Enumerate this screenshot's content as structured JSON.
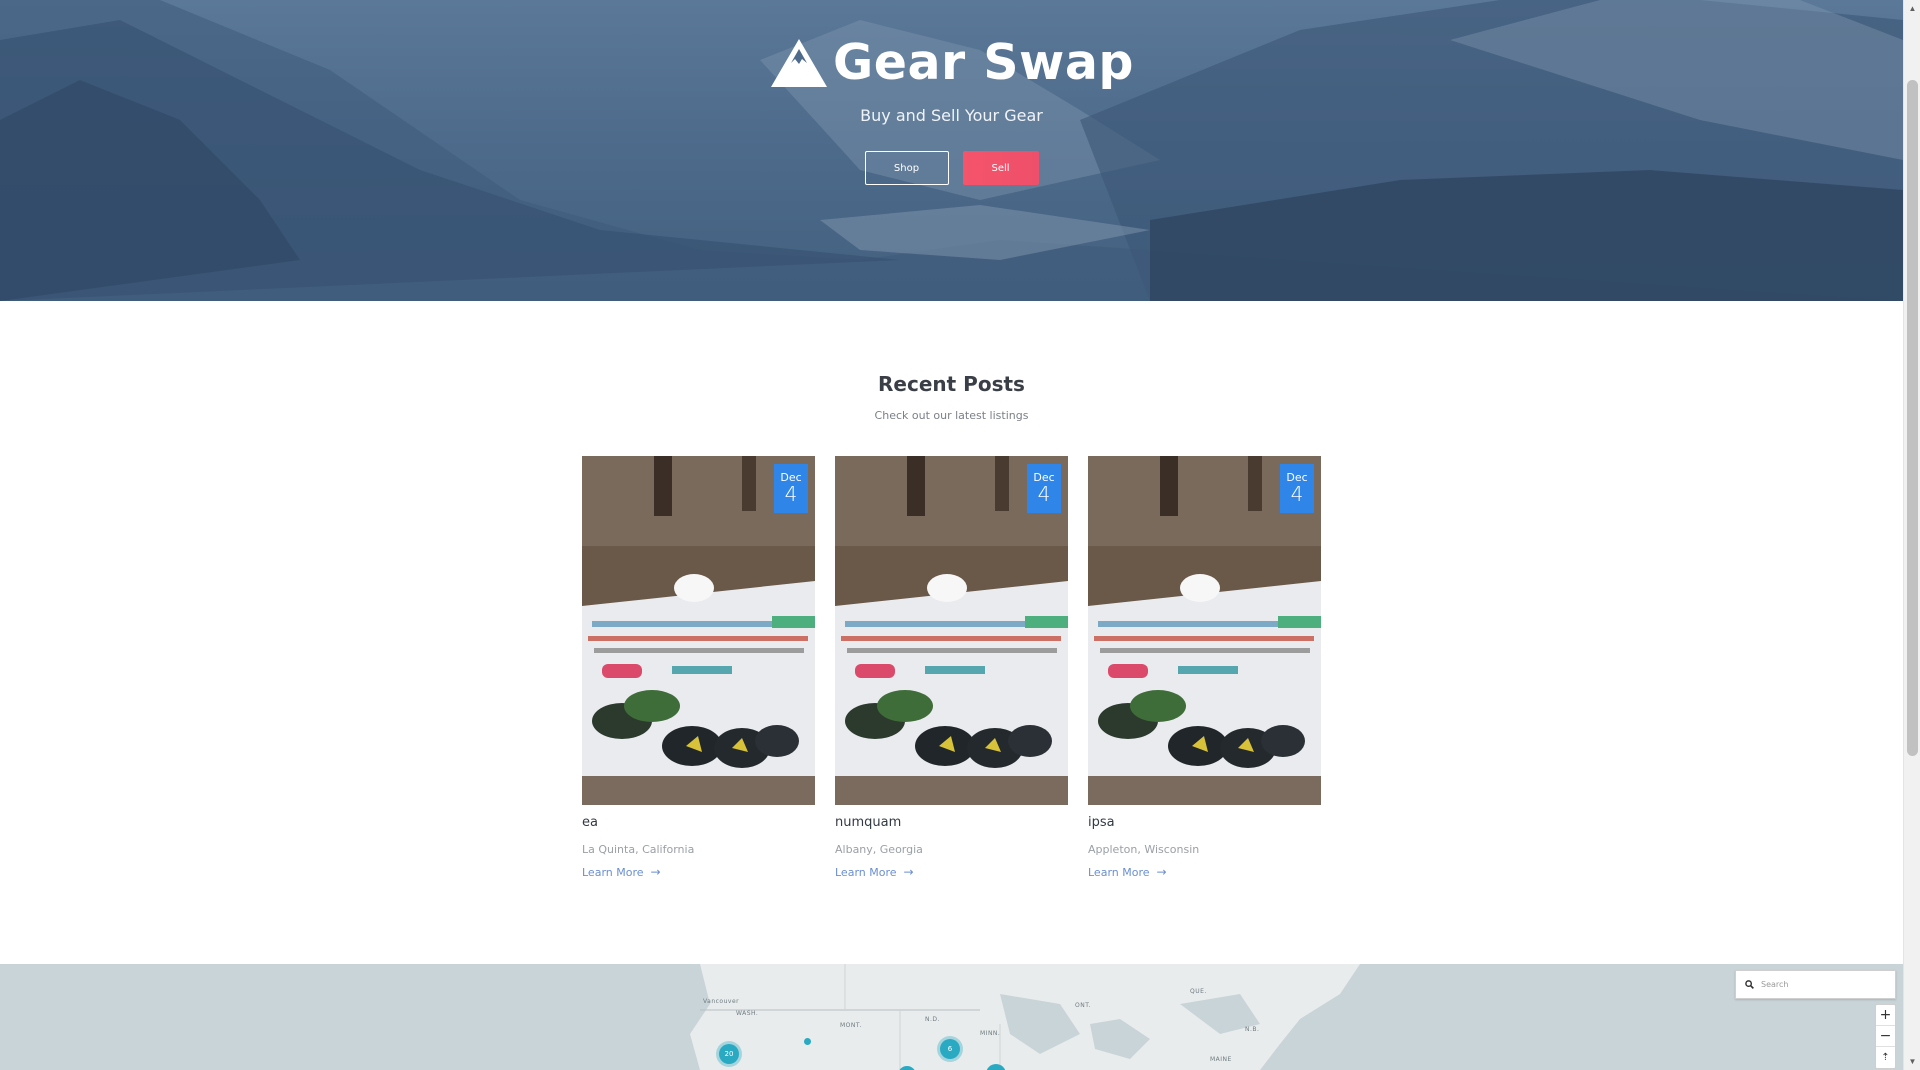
{
  "hero": {
    "title": "Gear Swap",
    "tagline": "Buy and Sell Your Gear",
    "shop_label": "Shop",
    "sell_label": "Sell"
  },
  "recent": {
    "title": "Recent Posts",
    "subtitle": "Check out our latest listings"
  },
  "posts": [
    {
      "month": "Dec",
      "day": "4",
      "title": "ea",
      "location": "La Quinta, California",
      "link": "Learn More"
    },
    {
      "month": "Dec",
      "day": "4",
      "title": "numquam",
      "location": "Albany, Georgia",
      "link": "Learn More"
    },
    {
      "month": "Dec",
      "day": "4",
      "title": "ipsa",
      "location": "Appleton, Wisconsin",
      "link": "Learn More"
    }
  ],
  "map": {
    "search_placeholder": "Search",
    "zoom_in": "+",
    "zoom_out": "−",
    "reset": "⇡",
    "labels": [
      "Vancouver",
      "WASH.",
      "MONT.",
      "N.D.",
      "MINN.",
      "ONT.",
      "QUE.",
      "N.B.",
      "MAINE"
    ],
    "clusters": [
      "20",
      "6"
    ]
  },
  "colors": {
    "hero_overlay": "#4e6b8c",
    "sell_button": "#f5546b",
    "date_badge": "#2f86e8",
    "link": "#6b8fd2",
    "cluster": "#2aa9c3"
  }
}
